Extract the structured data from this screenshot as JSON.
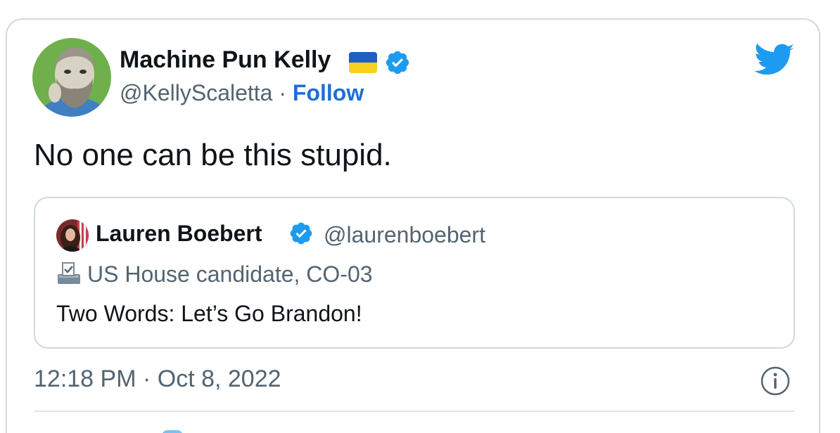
{
  "tweet": {
    "author_name": "Machine Pun Kelly",
    "author_flag": "ukraine-flag",
    "handle": "@KellyScaletta",
    "separator": "·",
    "follow_label": "Follow",
    "text": "No one can be this stupid.",
    "timestamp": "12:18 PM · Oct 8, 2022"
  },
  "quoted": {
    "author_name": "Lauren Boebert",
    "handle": "@laurenboebert",
    "label": "US House candidate, CO-03",
    "text": "Two Words: Let’s Go Brandon!"
  },
  "colors": {
    "twitter_blue": "#1d9bf0",
    "follow_blue": "#1d6fd4",
    "secondary_text": "#536471",
    "border": "#cfd9de"
  }
}
